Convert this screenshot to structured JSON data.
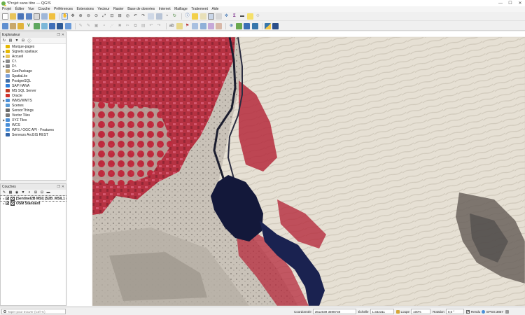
{
  "window": {
    "title": "*Projet sans titre — QGIS",
    "minimize": "—",
    "maximize": "☐",
    "close": "✕"
  },
  "menu": [
    "Projet",
    "Éditer",
    "Vue",
    "Couche",
    "Préférences",
    "Extensions",
    "Vecteur",
    "Raster",
    "Base de données",
    "Internet",
    "Maillage",
    "Traitement",
    "Aide"
  ],
  "explorer": {
    "title": "Explorateur",
    "items": [
      {
        "label": "Marque-pages",
        "icon": "bookmark-icon",
        "color": "#e6b800",
        "arrow": ""
      },
      {
        "label": "Signets spatiaux",
        "icon": "spatial-bookmark-icon",
        "color": "#e6b800",
        "arrow": "▶"
      },
      {
        "label": "Accueil",
        "icon": "home-folder-icon",
        "color": "#e6c35c",
        "arrow": "▶"
      },
      {
        "label": "C:\\",
        "icon": "drive-icon",
        "color": "#8c8c8c",
        "arrow": "▶"
      },
      {
        "label": "D:\\",
        "icon": "drive-icon",
        "color": "#8c8c8c",
        "arrow": "▶"
      },
      {
        "label": "GeoPackage",
        "icon": "geopackage-icon",
        "color": "#c8a86a",
        "arrow": ""
      },
      {
        "label": "SpatiaLite",
        "icon": "spatialite-icon",
        "color": "#7aa0d8",
        "arrow": ""
      },
      {
        "label": "PostgreSQL",
        "icon": "postgresql-icon",
        "color": "#3e6ea8",
        "arrow": ""
      },
      {
        "label": "SAP HANA",
        "icon": "sap-hana-icon",
        "color": "#2f7ed8",
        "arrow": ""
      },
      {
        "label": "MS SQL Server",
        "icon": "mssql-icon",
        "color": "#c23b22",
        "arrow": ""
      },
      {
        "label": "Oracle",
        "icon": "oracle-icon",
        "color": "#d0312d",
        "arrow": ""
      },
      {
        "label": "WMS/WMTS",
        "icon": "wms-icon",
        "color": "#4a8fd8",
        "arrow": "▶"
      },
      {
        "label": "Scenes",
        "icon": "scenes-icon",
        "color": "#5b9bd5",
        "arrow": ""
      },
      {
        "label": "SensorThings",
        "icon": "sensorthings-icon",
        "color": "#6a6a6a",
        "arrow": ""
      },
      {
        "label": "Vector Tiles",
        "icon": "vector-tiles-icon",
        "color": "#7b7b7b",
        "arrow": ""
      },
      {
        "label": "XYZ Tiles",
        "icon": "xyz-tiles-icon",
        "color": "#4a8fd8",
        "arrow": "▶"
      },
      {
        "label": "WCS",
        "icon": "wcs-icon",
        "color": "#4a8fd8",
        "arrow": ""
      },
      {
        "label": "WFS / OGC API - Features",
        "icon": "wfs-icon",
        "color": "#4a8fd8",
        "arrow": ""
      },
      {
        "label": "Serveurs ArcGIS REST",
        "icon": "arcgis-icon",
        "color": "#3366aa",
        "arrow": ""
      }
    ]
  },
  "layers": {
    "title": "Couches",
    "items": [
      {
        "label": "[Sentinel2B MSI] [S2B_MSIL1",
        "checked": "✔",
        "bold": true
      },
      {
        "label": "OSM Standard",
        "checked": "✔",
        "bold": true
      }
    ]
  },
  "status": {
    "locator_placeholder": "Taper pour trouver (Ctrl+K)",
    "coord_label": "Coordonnée",
    "coord_value": "3612039 3598738",
    "scale_label": "Échelle",
    "scale_value": "1:332311",
    "magnifier_label": "Loupe",
    "magnifier_value": "100%",
    "rotation_label": "Rotation",
    "rotation_value": "0,0 °",
    "render_label": "Rendu",
    "crs_label": "EPSG:3857"
  },
  "colors": {
    "vegetation_red": "#b8263a",
    "desert": "#e3ddd2",
    "water": "#13183a",
    "dark_rock": "#4f4b4a"
  }
}
